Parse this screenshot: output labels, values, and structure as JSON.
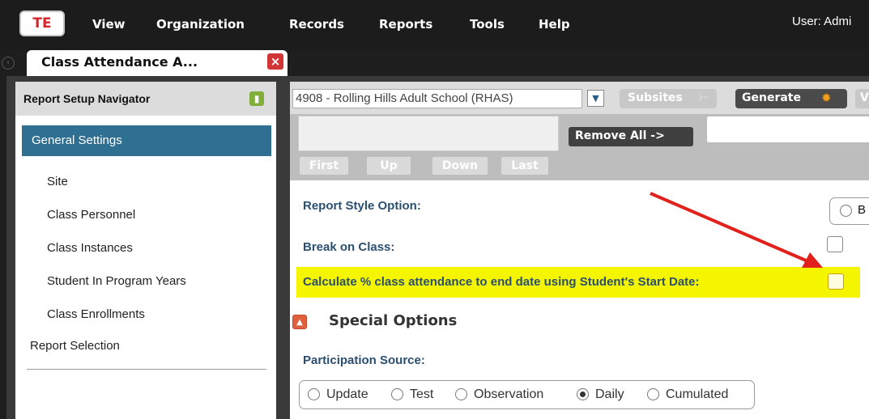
{
  "app": {
    "logo_text": "TE",
    "menu": [
      "View",
      "Organization",
      "Records",
      "Reports",
      "Tools",
      "Help"
    ],
    "user_text": "User: Admi"
  },
  "tab": {
    "title": "Class Attendance A...",
    "close": "×"
  },
  "navigator": {
    "title": "Report Setup Navigator",
    "selected": "General Settings",
    "items": [
      "Site",
      "Class Personnel",
      "Class Instances",
      "Student In Program Years",
      "Class Enrollments"
    ],
    "report_selection": "Report Selection"
  },
  "toolbar": {
    "site_select": "4908 - Rolling Hills Adult School (RHAS)",
    "subsites": "Subsites",
    "generate": "Generate",
    "v_label": "V"
  },
  "ordering": {
    "remove_all": "Remove All ->",
    "buttons": [
      "First",
      "Up",
      "Down",
      "Last"
    ]
  },
  "options": {
    "report_style": "Report Style Option:",
    "report_style_value": "B",
    "break_on_class": "Break on Class:",
    "calc_pct": "Calculate % class attendance to end date using Student's Start Date:"
  },
  "special": {
    "title": "Special Options",
    "participation_label": "Participation Source:",
    "sources": [
      "Update",
      "Test",
      "Observation",
      "Daily",
      "Cumulated"
    ],
    "selected_source": "Daily"
  },
  "colors": {
    "highlight": "#f5f500",
    "selected_nav": "#2f6f92",
    "arrow": "#e2201c"
  }
}
